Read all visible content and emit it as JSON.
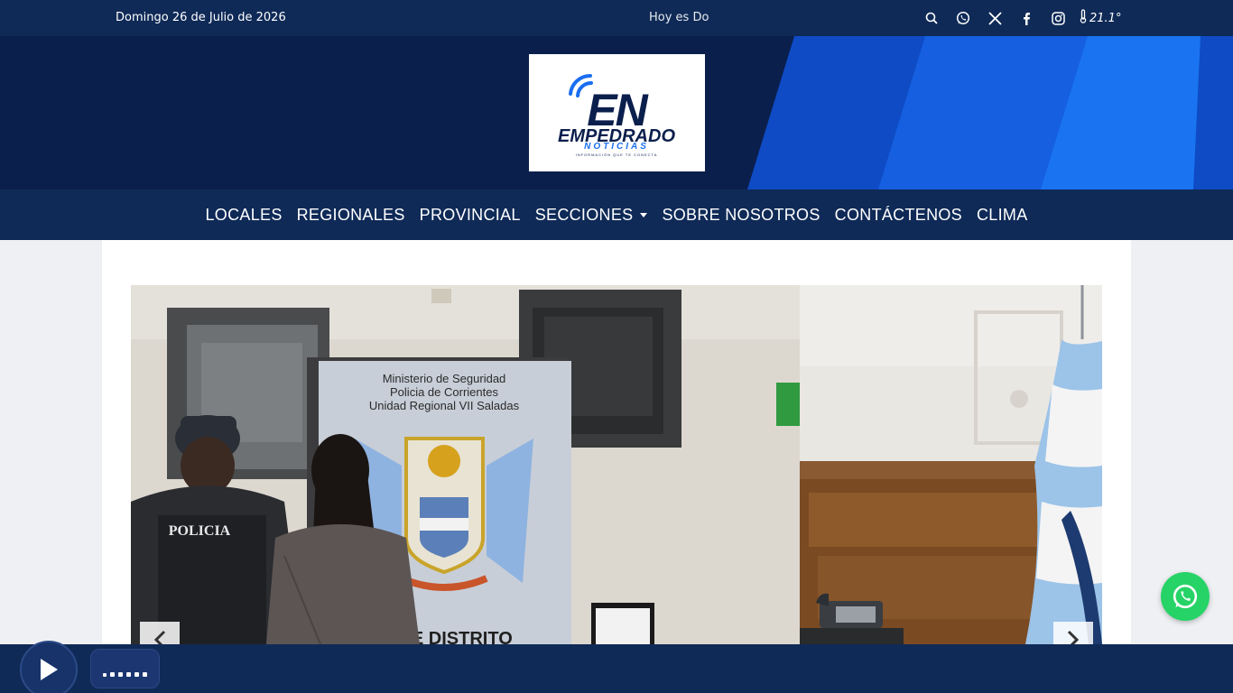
{
  "topbar": {
    "date": "Domingo 26 de Julio de 2026",
    "ticker": "Hoy es Do",
    "temperature": "21.1°",
    "icons": [
      "search-icon",
      "whatsapp-icon",
      "x-icon",
      "facebook-icon",
      "instagram-icon",
      "thermometer-icon"
    ]
  },
  "logo": {
    "initials": "EN",
    "name": "EMPEDRADO",
    "sub": "NOTICIAS",
    "tagline": "INFORMACIÓN QUE TE CONECTA"
  },
  "nav": {
    "items": [
      "LOCALES",
      "REGIONALES",
      "PROVINCIAL",
      "SECCIONES",
      "SOBRE NOSOTROS",
      "CONTÁCTENOS",
      "CLIMA"
    ]
  },
  "slides": [
    {
      "sign_line1": "Ministerio de Seguridad",
      "sign_line2": "Policia de Corrientes",
      "sign_line3": "Unidad Regional VII Saladas",
      "vest_label": "POLICIA",
      "bottom_text": "RIA DE DISTRITO"
    },
    {}
  ],
  "player": {
    "state": "paused"
  },
  "colors": {
    "topbar": "#0f2a57",
    "header": "#0b1f4d",
    "accent_blue": "#1a6ef0",
    "whatsapp": "#25d366"
  }
}
